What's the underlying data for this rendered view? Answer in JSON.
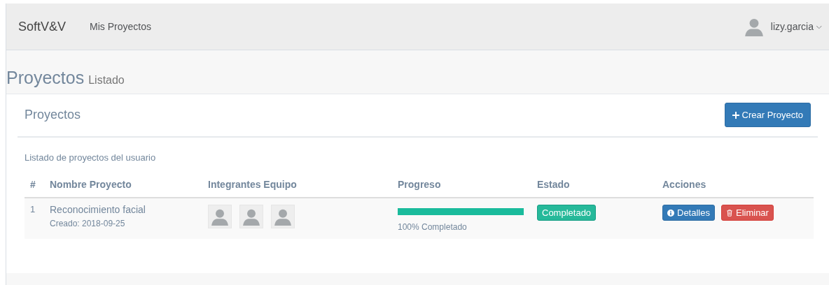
{
  "navbar": {
    "brand": "SoftV&V",
    "links": [
      "Mis Proyectos"
    ],
    "user": {
      "name": "lizy.garcia",
      "caret": "⌵"
    }
  },
  "page_header": {
    "title": "Proyectos",
    "subtitle": "Listado"
  },
  "panel": {
    "title": "Proyectos",
    "create_button": {
      "label": "Crear Proyecto"
    },
    "description": "Listado de proyectos del usuario",
    "table": {
      "columns": [
        "#",
        "Nombre Proyecto",
        "Integrantes Equipo",
        "Progreso",
        "Estado",
        "Acciones"
      ],
      "rows": [
        {
          "index": "1",
          "name": "Reconocimiento facial",
          "created": "Creado: 2018-09-25",
          "team": [
            {
              "kind": "avatar"
            },
            {
              "kind": "avatar"
            },
            {
              "kind": "avatar"
            }
          ],
          "progress": {
            "level": 1,
            "label": "100% Completado"
          },
          "status": {
            "label": "Completado",
            "kind": "success"
          },
          "actions": [
            {
              "label": "Detalles",
              "kind": "info"
            },
            {
              "label": "Eliminar",
              "kind": "danger"
            }
          ]
        }
      ]
    }
  }
}
